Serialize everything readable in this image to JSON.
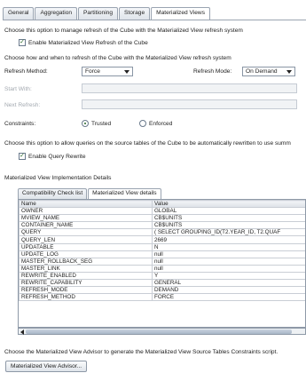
{
  "tabs": [
    "General",
    "Aggregation",
    "Partitioning",
    "Storage",
    "Materialized Views"
  ],
  "active_tab": 4,
  "refresh_section": {
    "description": "Choose this option to manage refresh of the Cube with the Materialized View refresh system",
    "enable_refresh_checkbox_label": "Enable Materialized View Refresh of the Cube",
    "enable_refresh_checked": true,
    "how_when_text": "Choose how and when to refresh of the Cube with the Materialized View refresh system",
    "refresh_method_label": "Refresh Method:",
    "refresh_method_value": "Force",
    "refresh_mode_label": "Refresh Mode:",
    "refresh_mode_value": "On Demand",
    "start_with_label": "Start With:",
    "next_refresh_label": "Next Refresh:",
    "constraints_label": "Constraints:",
    "trusted_label": "Trusted",
    "enforced_label": "Enforced",
    "constraints_selected": "Trusted"
  },
  "rewrite_section": {
    "description": "Choose this option to allow queries on the source tables of the Cube to be automatically rewritten to use summ",
    "enable_rewrite_label": "Enable Query Rewrite",
    "enable_rewrite_checked": true
  },
  "implementation": {
    "title": "Materialized View Implementation Details",
    "subtabs": [
      "Compatibility Check list",
      "Materialized View details"
    ],
    "active_subtab": 1,
    "columns": [
      "Name",
      "Value"
    ],
    "rows": [
      [
        "OWNER",
        "GLOBAL"
      ],
      [
        "MVIEW_NAME",
        "CB$UNITS"
      ],
      [
        "CONTAINER_NAME",
        "CB$UNITS"
      ],
      [
        "QUERY",
        "( SELECT   GROUPING_ID(T2.YEAR_ID, T2.QUAF"
      ],
      [
        "QUERY_LEN",
        "2669"
      ],
      [
        "UPDATABLE",
        "N"
      ],
      [
        "UPDATE_LOG",
        "null"
      ],
      [
        "MASTER_ROLLBACK_SEG",
        "null"
      ],
      [
        "MASTER_LINK",
        "null"
      ],
      [
        "REWRITE_ENABLED",
        "Y"
      ],
      [
        "REWRITE_CAPABILITY",
        "GENERAL"
      ],
      [
        "REFRESH_MODE",
        "DEMAND"
      ],
      [
        "REFRESH_METHOD",
        "FORCE"
      ]
    ]
  },
  "advisor": {
    "description": "Choose the Materialized View Advisor to generate the Materialized View Source Tables Constraints script.",
    "button_label": "Materialized View Advisor..."
  }
}
